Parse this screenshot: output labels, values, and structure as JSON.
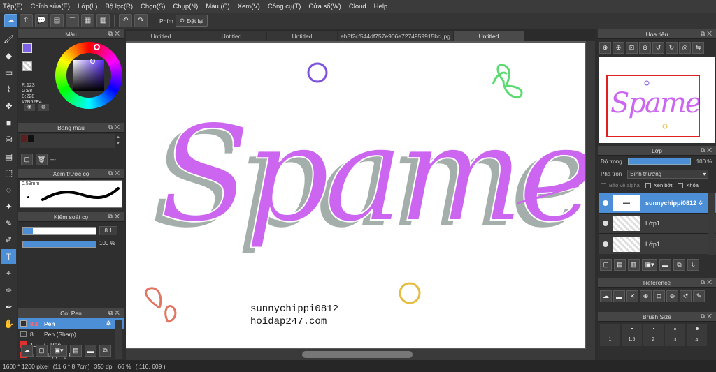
{
  "menu": [
    "Tệp(F)",
    "Chỉnh sửa(E)",
    "Lớp(L)",
    "Bộ lọc(R)",
    "Chọn(S)",
    "Chụp(N)",
    "Màu (C)",
    "Xem(V)",
    "Công cụ(T)",
    "Cửa sổ(W)",
    "Cloud",
    "Help"
  ],
  "toolbar": {
    "plain_label": "Phím",
    "reset_label": "Đặt lại"
  },
  "color_panel": {
    "title": "Màu",
    "r": "R:123",
    "g": "G:98",
    "b": "B:228",
    "hex": "#7B62E4"
  },
  "swatch_panel": {
    "title": "Bảng màu",
    "dash": "---"
  },
  "brush_preview": {
    "title": "Xem trước cọ",
    "size": "0.59mm"
  },
  "brush_control": {
    "title": "Kiểm soát cọ",
    "size_value": "8.1",
    "opacity_value": "100 %"
  },
  "brush_list": {
    "title": "Cọ: Pen",
    "items": [
      {
        "size": "8.1",
        "name": "Pen"
      },
      {
        "size": "8",
        "name": "Pen (Sharp)"
      },
      {
        "size": "10",
        "name": "G Pen"
      },
      {
        "size": "8",
        "name": "Mapping Pen"
      }
    ]
  },
  "tabs": [
    "Untitled",
    "Untitled",
    "Untitled",
    "eb3f2cf544df757e906e7274959915bc.jpg",
    "Untitled"
  ],
  "canvas": {
    "title_text": "Spame",
    "credit_line1": "sunnychippi0812",
    "credit_line2": "hoidap247.com"
  },
  "navigator": {
    "title": "Hoa tiêu"
  },
  "layer_panel": {
    "title": "Lớp",
    "opacity_label": "Độ trong",
    "opacity_value": "100 %",
    "blend_label": "Pha trộn",
    "blend_value": "Bình thường",
    "protect_alpha": "Bảo vệ alpha",
    "clipping": "Xén bớt",
    "lock": "Khóa",
    "layers": [
      {
        "name": "sunnychippi0812"
      },
      {
        "name": "Lớp1"
      },
      {
        "name": "Lớp1"
      }
    ]
  },
  "reference_panel": {
    "title": "Reference"
  },
  "brush_size_panel": {
    "title": "Brush Size",
    "sizes": [
      "1",
      "1.5",
      "2",
      "3",
      "4"
    ]
  },
  "status": {
    "dims": "1600 * 1200 pixel",
    "cm": "(11.6 * 8.7cm)",
    "dpi": "350 dpi",
    "zoom": "66 %",
    "coords": "( 110, 609 )"
  },
  "colors": {
    "accent": "#4d8fd6",
    "fg": "#7b62e4",
    "letter_fill": "#cc66f0",
    "letter_shadow": "#a4aeaa"
  }
}
